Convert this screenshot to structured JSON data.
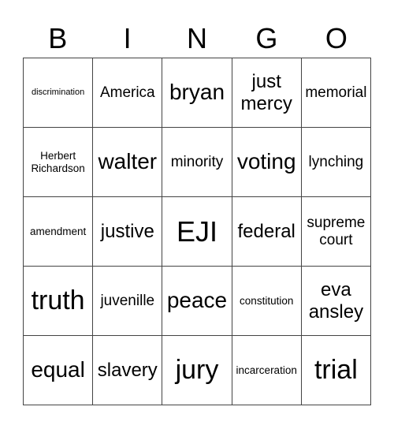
{
  "header": [
    "B",
    "I",
    "N",
    "G",
    "O"
  ],
  "cells": [
    [
      "discrimination",
      "America",
      "bryan",
      "just mercy",
      "memorial"
    ],
    [
      "Herbert Richardson",
      "walter",
      "minority",
      "voting",
      "lynching"
    ],
    [
      "amendment",
      "justive",
      "EJI",
      "federal",
      "supreme court"
    ],
    [
      "truth",
      "juvenille",
      "peace",
      "constitution",
      "eva ansley"
    ],
    [
      "equal",
      "slavery",
      "jury",
      "incarceration",
      "trial"
    ]
  ]
}
